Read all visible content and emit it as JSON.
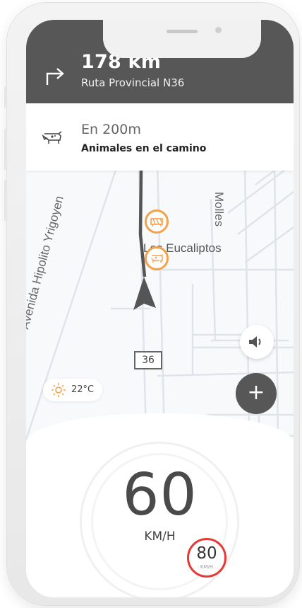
{
  "navigation": {
    "distance": "178 km",
    "road": "Ruta Provincial N36",
    "maneuver_icon": "turn-right-icon"
  },
  "alert": {
    "icon": "cow-icon",
    "distance": "En 200m",
    "message": "Animales en el camino"
  },
  "map": {
    "streets": {
      "avenida": "Avenida Hipolito Yrigoyen",
      "molles": "Molles",
      "eucaliptos": "Los Eucaliptos"
    },
    "route_badge": "36",
    "markers": [
      "road-works-icon",
      "cow-icon"
    ],
    "route_color": "#555555",
    "marker_color": "#f5a04a"
  },
  "weather": {
    "icon": "sun-icon",
    "temperature": "22°C"
  },
  "controls": {
    "sound_icon": "speaker-icon",
    "zoom_label": "+"
  },
  "speedometer": {
    "speed": "60",
    "unit": "KM/H",
    "limit": "80",
    "limit_unit": "KM/H",
    "limit_color": "#e53935"
  }
}
